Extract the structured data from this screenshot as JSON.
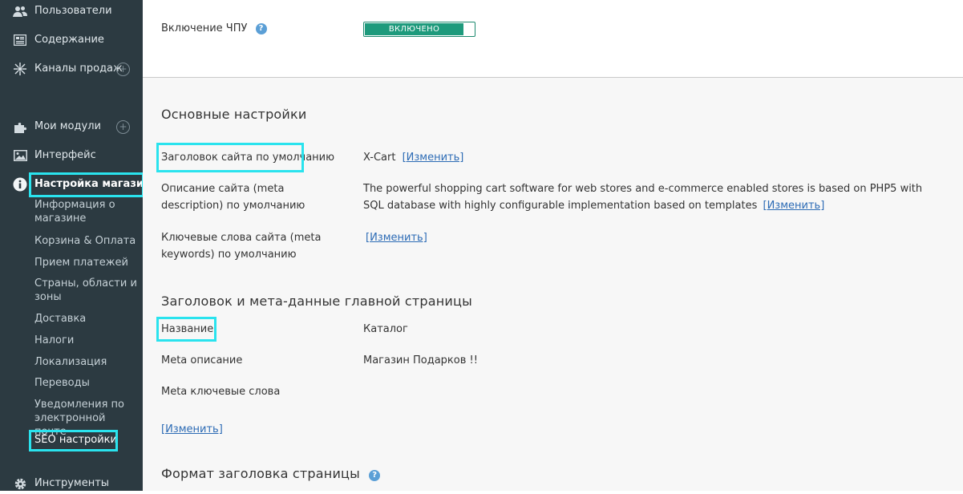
{
  "sidebar": {
    "items": [
      {
        "label": "Пользователи",
        "icon": "users-icon"
      },
      {
        "label": "Содержание",
        "icon": "content-icon"
      },
      {
        "label": "Каналы продаж",
        "icon": "channels-icon",
        "plus": "+"
      },
      {
        "label": "Мои модули",
        "icon": "puzzle-icon",
        "plus": "+"
      },
      {
        "label": "Интерфейс",
        "icon": "image-icon"
      },
      {
        "label": "Настройка магазина",
        "icon": "info-icon"
      },
      {
        "label": "Инструменты",
        "icon": "gear-icon"
      }
    ],
    "submenu": [
      "Информация о магазине",
      "Корзина & Оплата",
      "Прием платежей",
      "Страны, области и зоны",
      "Доставка",
      "Налоги",
      "Локализация",
      "Переводы",
      "Уведомления по электронной почте",
      "SEO настройки"
    ]
  },
  "top": {
    "sef_label": "Включение ЧПУ",
    "toggle_label": "ВКЛЮЧЕНО",
    "help": "?"
  },
  "basic": {
    "title": "Основные настройки",
    "site_title_label": "Заголовок сайта по умолчанию",
    "site_title_value": "X-Cart",
    "meta_desc_label": "Описание сайта (meta description) по умолчанию",
    "meta_desc_value": "The powerful shopping cart software for web stores and e-commerce enabled stores is based on PHP5 with SQL database with highly configurable implementation based on templates",
    "meta_keywords_label": "Ключевые слова сайта (meta keywords) по умолчанию",
    "change_link": "[Изменить]"
  },
  "home": {
    "title": "Заголовок и мета-данные главной страницы",
    "name_label": "Название",
    "name_value": "Каталог",
    "meta_desc_label": "Meta описание",
    "meta_desc_value": "Магазин Подарков !!",
    "meta_keywords_label": "Meta ключевые слова",
    "change_link": "[Изменить]"
  },
  "format": {
    "title": "Формат заголовка страницы",
    "help": "?"
  },
  "colors": {
    "sidebar_bg": "#2c3a41",
    "highlight": "#2ae3ee",
    "toggle_green": "#1e9a7c",
    "link": "#2c6bb5"
  }
}
